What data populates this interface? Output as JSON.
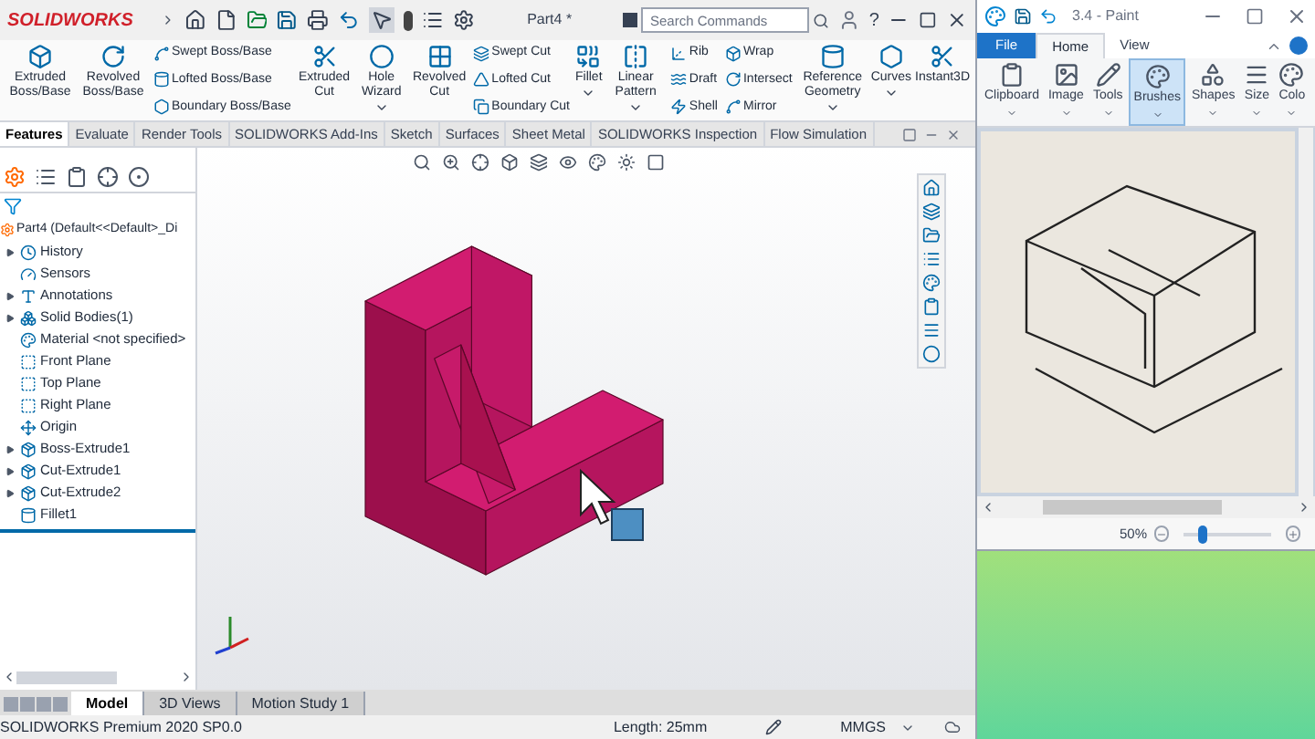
{
  "solidworks": {
    "logo": "SOLIDWORKS",
    "title": "Part4 *",
    "search": {
      "placeholder": "Search Commands"
    },
    "help": "?",
    "ribbon": [
      {
        "kind": "large",
        "label": "Extruded Boss/Base",
        "dropdown": false
      },
      {
        "kind": "large",
        "label": "Revolved Boss/Base",
        "dropdown": false
      },
      {
        "kind": "stack",
        "items": [
          "Swept Boss/Base",
          "Lofted Boss/Base",
          "Boundary Boss/Base"
        ]
      },
      {
        "kind": "large",
        "label": "Extruded Cut",
        "dropdown": false
      },
      {
        "kind": "large",
        "label": "Hole Wizard",
        "dropdown": true
      },
      {
        "kind": "large",
        "label": "Revolved Cut",
        "dropdown": false
      },
      {
        "kind": "stack",
        "items": [
          "Swept Cut",
          "Lofted Cut",
          "Boundary Cut"
        ]
      },
      {
        "kind": "large",
        "label": "Fillet",
        "dropdown": true
      },
      {
        "kind": "large",
        "label": "Linear Pattern",
        "dropdown": true
      },
      {
        "kind": "stack",
        "items": [
          "Rib",
          "Draft",
          "Shell"
        ]
      },
      {
        "kind": "stack",
        "items": [
          "Wrap",
          "Intersect",
          "Mirror"
        ]
      },
      {
        "kind": "large",
        "label": "Reference Geometry",
        "dropdown": true
      },
      {
        "kind": "large",
        "label": "Curves",
        "dropdown": true
      },
      {
        "kind": "large",
        "label": "Instant3D",
        "dropdown": false
      }
    ],
    "tabs": [
      {
        "label": "Features",
        "selected": true
      },
      {
        "label": "Evaluate",
        "selected": false
      },
      {
        "label": "Render Tools",
        "selected": false
      },
      {
        "label": "SOLIDWORKS Add-Ins",
        "selected": false
      },
      {
        "label": "Sketch",
        "selected": false
      },
      {
        "label": "Surfaces",
        "selected": false
      },
      {
        "label": "Sheet Metal",
        "selected": false
      },
      {
        "label": "SOLIDWORKS Inspection",
        "selected": false
      },
      {
        "label": "Flow Simulation",
        "selected": false
      }
    ],
    "tree": {
      "root": "Part4  (Default<<Default>_Di",
      "items": [
        {
          "kind": "history",
          "label": "History",
          "expandable": true
        },
        {
          "kind": "sensor",
          "label": "Sensors",
          "expandable": false
        },
        {
          "kind": "annotation",
          "label": "Annotations",
          "expandable": true
        },
        {
          "kind": "bodies",
          "label": "Solid Bodies(1)",
          "expandable": true
        },
        {
          "kind": "material",
          "label": "Material <not specified>",
          "expandable": false
        },
        {
          "kind": "plane",
          "label": "Front Plane",
          "expandable": false
        },
        {
          "kind": "plane",
          "label": "Top Plane",
          "expandable": false
        },
        {
          "kind": "plane",
          "label": "Right Plane",
          "expandable": false
        },
        {
          "kind": "origin",
          "label": "Origin",
          "expandable": false
        },
        {
          "kind": "feature",
          "label": "Boss-Extrude1",
          "expandable": true
        },
        {
          "kind": "feature",
          "label": "Cut-Extrude1",
          "expandable": true
        },
        {
          "kind": "feature",
          "label": "Cut-Extrude2",
          "expandable": true
        },
        {
          "kind": "fillet",
          "label": "Fillet1",
          "expandable": false
        }
      ]
    },
    "bottom_tabs": [
      {
        "label": "Model",
        "selected": true
      },
      {
        "label": "3D Views",
        "selected": false
      },
      {
        "label": "Motion Study 1",
        "selected": false
      }
    ],
    "status_bar": {
      "product": "SOLIDWORKS Premium 2020 SP0.0",
      "length": "Length: 25mm",
      "units": "MMGS"
    }
  },
  "paint": {
    "title": "3.4 - Paint",
    "tabs": [
      {
        "kind": "file",
        "label": "File",
        "selected": false
      },
      {
        "kind": "tab",
        "label": "Home",
        "selected": true
      },
      {
        "kind": "tab",
        "label": "View",
        "selected": false
      }
    ],
    "groups": [
      {
        "label": "Clipboard",
        "selected": false
      },
      {
        "label": "Image",
        "selected": false
      },
      {
        "label": "Tools",
        "selected": false
      },
      {
        "label": "Brushes",
        "selected": true
      },
      {
        "label": "Shapes",
        "selected": false
      },
      {
        "label": "Size",
        "selected": false
      },
      {
        "label": "Colo",
        "selected": false
      }
    ],
    "zoom": {
      "reading": "50%",
      "level": 0.2
    }
  }
}
